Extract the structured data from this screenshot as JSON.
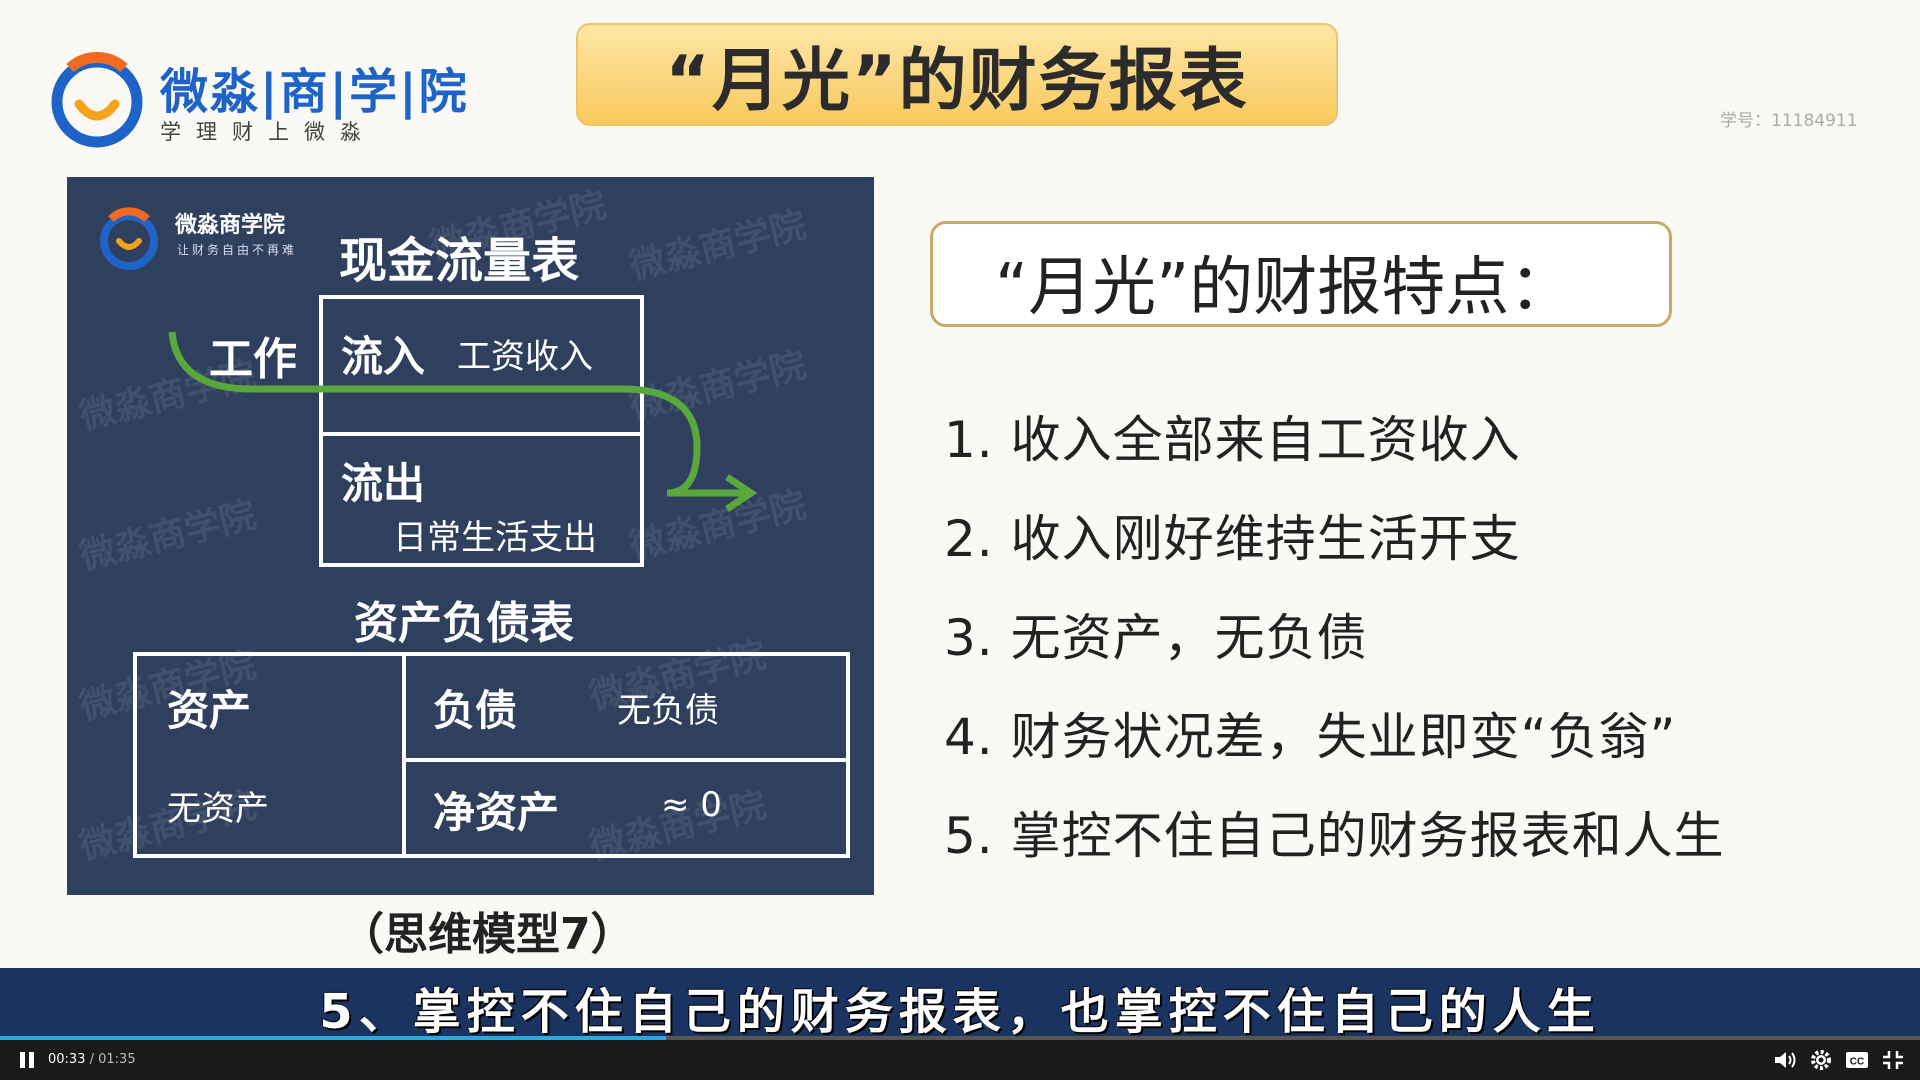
{
  "logo": {
    "name": "微淼|商|学|院",
    "slogan": "学理财上微淼"
  },
  "slide": {
    "title": "“月光”的财务报表",
    "student_id": "学号：11184911",
    "panel": {
      "logo_name": "微淼商学院",
      "logo_slogan": "让财务自由不再难",
      "watermark": "微淼商学院",
      "cashflow_title": "现金流量表",
      "work_label": "工作",
      "inflow_label": "流入",
      "inflow_value": "工资收入",
      "outflow_label": "流出",
      "outflow_value": "日常生活支出",
      "balance_title": "资产负债表",
      "assets_label": "资产",
      "assets_value": "无资产",
      "liabilities_label": "负债",
      "liabilities_value": "无负债",
      "networth_label": "净资产",
      "networth_value": "≈ 0"
    },
    "caption": "（思维模型7）",
    "features_title": "“月光”的财报特点：",
    "features": [
      "1. 收入全部来自工资收入",
      "2. 收入刚好维持生活开支",
      "3. 无资产，无负债",
      "4. 财务状况差，失业即变“负翁”",
      "5. 掌控不住自己的财务报表和人生"
    ]
  },
  "player": {
    "subtitle": "5、掌控不住自己的财务报表，也掌控不住自己的人生",
    "current_time": "00:33",
    "total_time": "01:35",
    "progress": 0.347,
    "accent": "#2aa8e0"
  }
}
